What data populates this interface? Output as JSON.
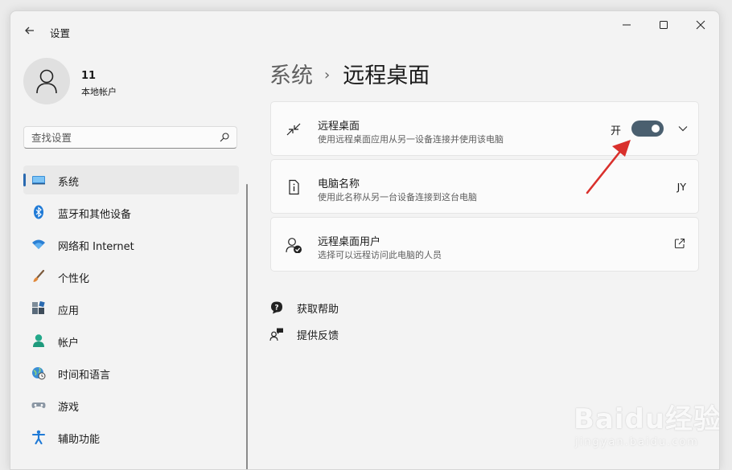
{
  "window": {
    "title": "设置"
  },
  "user": {
    "name": "11",
    "account_type": "本地帐户"
  },
  "search": {
    "placeholder": "查找设置"
  },
  "nav": {
    "items": [
      {
        "label": "系统",
        "icon": "system-icon",
        "selected": true
      },
      {
        "label": "蓝牙和其他设备",
        "icon": "bluetooth-icon"
      },
      {
        "label": "网络和 Internet",
        "icon": "wifi-icon"
      },
      {
        "label": "个性化",
        "icon": "brush-icon"
      },
      {
        "label": "应用",
        "icon": "apps-icon"
      },
      {
        "label": "帐户",
        "icon": "account-icon"
      },
      {
        "label": "时间和语言",
        "icon": "globe-clock-icon"
      },
      {
        "label": "游戏",
        "icon": "gamepad-icon"
      },
      {
        "label": "辅助功能",
        "icon": "accessibility-icon"
      }
    ]
  },
  "breadcrumb": {
    "parent": "系统",
    "separator": "›",
    "current": "远程桌面"
  },
  "cards": {
    "remote_desktop": {
      "title": "远程桌面",
      "description": "使用远程桌面应用从另一设备连接并使用该电脑",
      "toggle_state": "开",
      "toggle_on": true,
      "icon": "remote-desktop-icon"
    },
    "pc_name": {
      "title": "电脑名称",
      "description": "使用此名称从另一台设备连接到这台电脑",
      "value": "JY",
      "icon": "pc-name-icon"
    },
    "remote_users": {
      "title": "远程桌面用户",
      "description": "选择可以远程访问此电脑的人员",
      "icon": "remote-users-icon"
    }
  },
  "links": {
    "help": {
      "label": "获取帮助",
      "icon": "help-icon"
    },
    "feedback": {
      "label": "提供反馈",
      "icon": "feedback-icon"
    }
  },
  "watermark": {
    "main": "Baidu经验",
    "sub": "jingyan.baidu.com"
  },
  "colors": {
    "accent": "#2a6ab0",
    "toggle_on": "#4a5f6f",
    "annotation_arrow": "#d9302c"
  }
}
